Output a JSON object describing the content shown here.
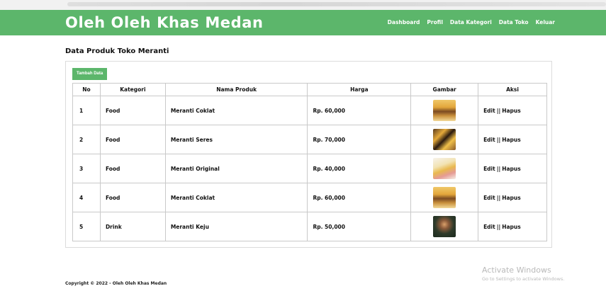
{
  "app": {
    "brand": "Oleh Oleh Khas Medan"
  },
  "nav": {
    "items": [
      "Dashboard",
      "Profil",
      "Data Kategori",
      "Data Toko",
      "Keluar"
    ]
  },
  "page": {
    "title": "Data Produk Toko Meranti",
    "add_button": "Tambah Data"
  },
  "table": {
    "headers": [
      "No",
      "Kategori",
      "Nama Produk",
      "Harga",
      "Gambar",
      "Aksi"
    ],
    "rows": [
      {
        "no": "1",
        "kategori": "Food",
        "nama": "Meranti Coklat",
        "harga": "Rp. 60,000",
        "edit": "Edit",
        "separator": "||",
        "hapus": "Hapus"
      },
      {
        "no": "2",
        "kategori": "Food",
        "nama": "Meranti Seres",
        "harga": "Rp. 70,000",
        "edit": "Edit",
        "separator": "||",
        "hapus": "Hapus"
      },
      {
        "no": "3",
        "kategori": "Food",
        "nama": "Meranti Original",
        "harga": "Rp. 40,000",
        "edit": "Edit",
        "separator": "||",
        "hapus": "Hapus"
      },
      {
        "no": "4",
        "kategori": "Food",
        "nama": "Meranti Coklat",
        "harga": "Rp. 60,000",
        "edit": "Edit",
        "separator": "||",
        "hapus": "Hapus"
      },
      {
        "no": "5",
        "kategori": "Drink",
        "nama": "Meranti Keju",
        "harga": "Rp. 50,000",
        "edit": "Edit",
        "separator": "||",
        "hapus": "Hapus"
      }
    ]
  },
  "footer": {
    "text": "Copyright © 2022 - Oleh Oleh Khas Medan"
  },
  "watermark": {
    "line1": "Activate Windows",
    "line2": "Go to Settings to activate Windows."
  },
  "colors": {
    "accent": "#5cb66b"
  }
}
